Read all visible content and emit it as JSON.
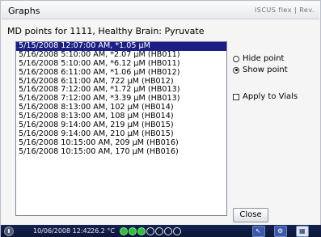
{
  "window": {
    "title": "Graphs",
    "brand": "ISCUS flex | Rev."
  },
  "subtitle": "MD points for 1111, Healthy Brain: Pyruvate",
  "points": [
    "5/15/2008 12:07:00 AM, *1.05 µM",
    "5/16/2008 5:10:00 AM, *2.07 µM (HB011)",
    "5/16/2008 5:10:00 AM, *6.12 µM (HB011)",
    "5/16/2008 6:11:00 AM, *1.06 µM (HB012)",
    "5/16/2008 6:11:00 AM, 722 µM (HB012)",
    "5/16/2008 7:12:00 AM, *1.72 µM (HB013)",
    "5/16/2008 7:12:00 AM, *3.39 µM (HB013)",
    "5/16/2008 8:13:00 AM, 102 µM (HB014)",
    "5/16/2008 8:13:00 AM, 108 µM (HB014)",
    "5/16/2008 9:14:00 AM, 219 µM (HB015)",
    "5/16/2008 9:14:00 AM, 210 µM (HB015)",
    "5/16/2008 10:15:00 AM, 209 µM (HB016)",
    "5/16/2008 10:15:00 AM, 170 µM (HB016)"
  ],
  "selected_index": 0,
  "options": {
    "hide_point": "Hide point",
    "show_point": "Show point",
    "selected": "show_point",
    "apply_to_vials": "Apply to Vials",
    "apply_checked": false
  },
  "buttons": {
    "close": "Close"
  },
  "taskbar": {
    "datetime": "10/06/2008 12:42",
    "temperature": "26.2 °C",
    "indicators_on": 3,
    "indicators_total": 7
  },
  "colors": {
    "selection": "#1b1f86",
    "taskbar": "#14234f",
    "indicator_on": "#2fbf3a"
  }
}
